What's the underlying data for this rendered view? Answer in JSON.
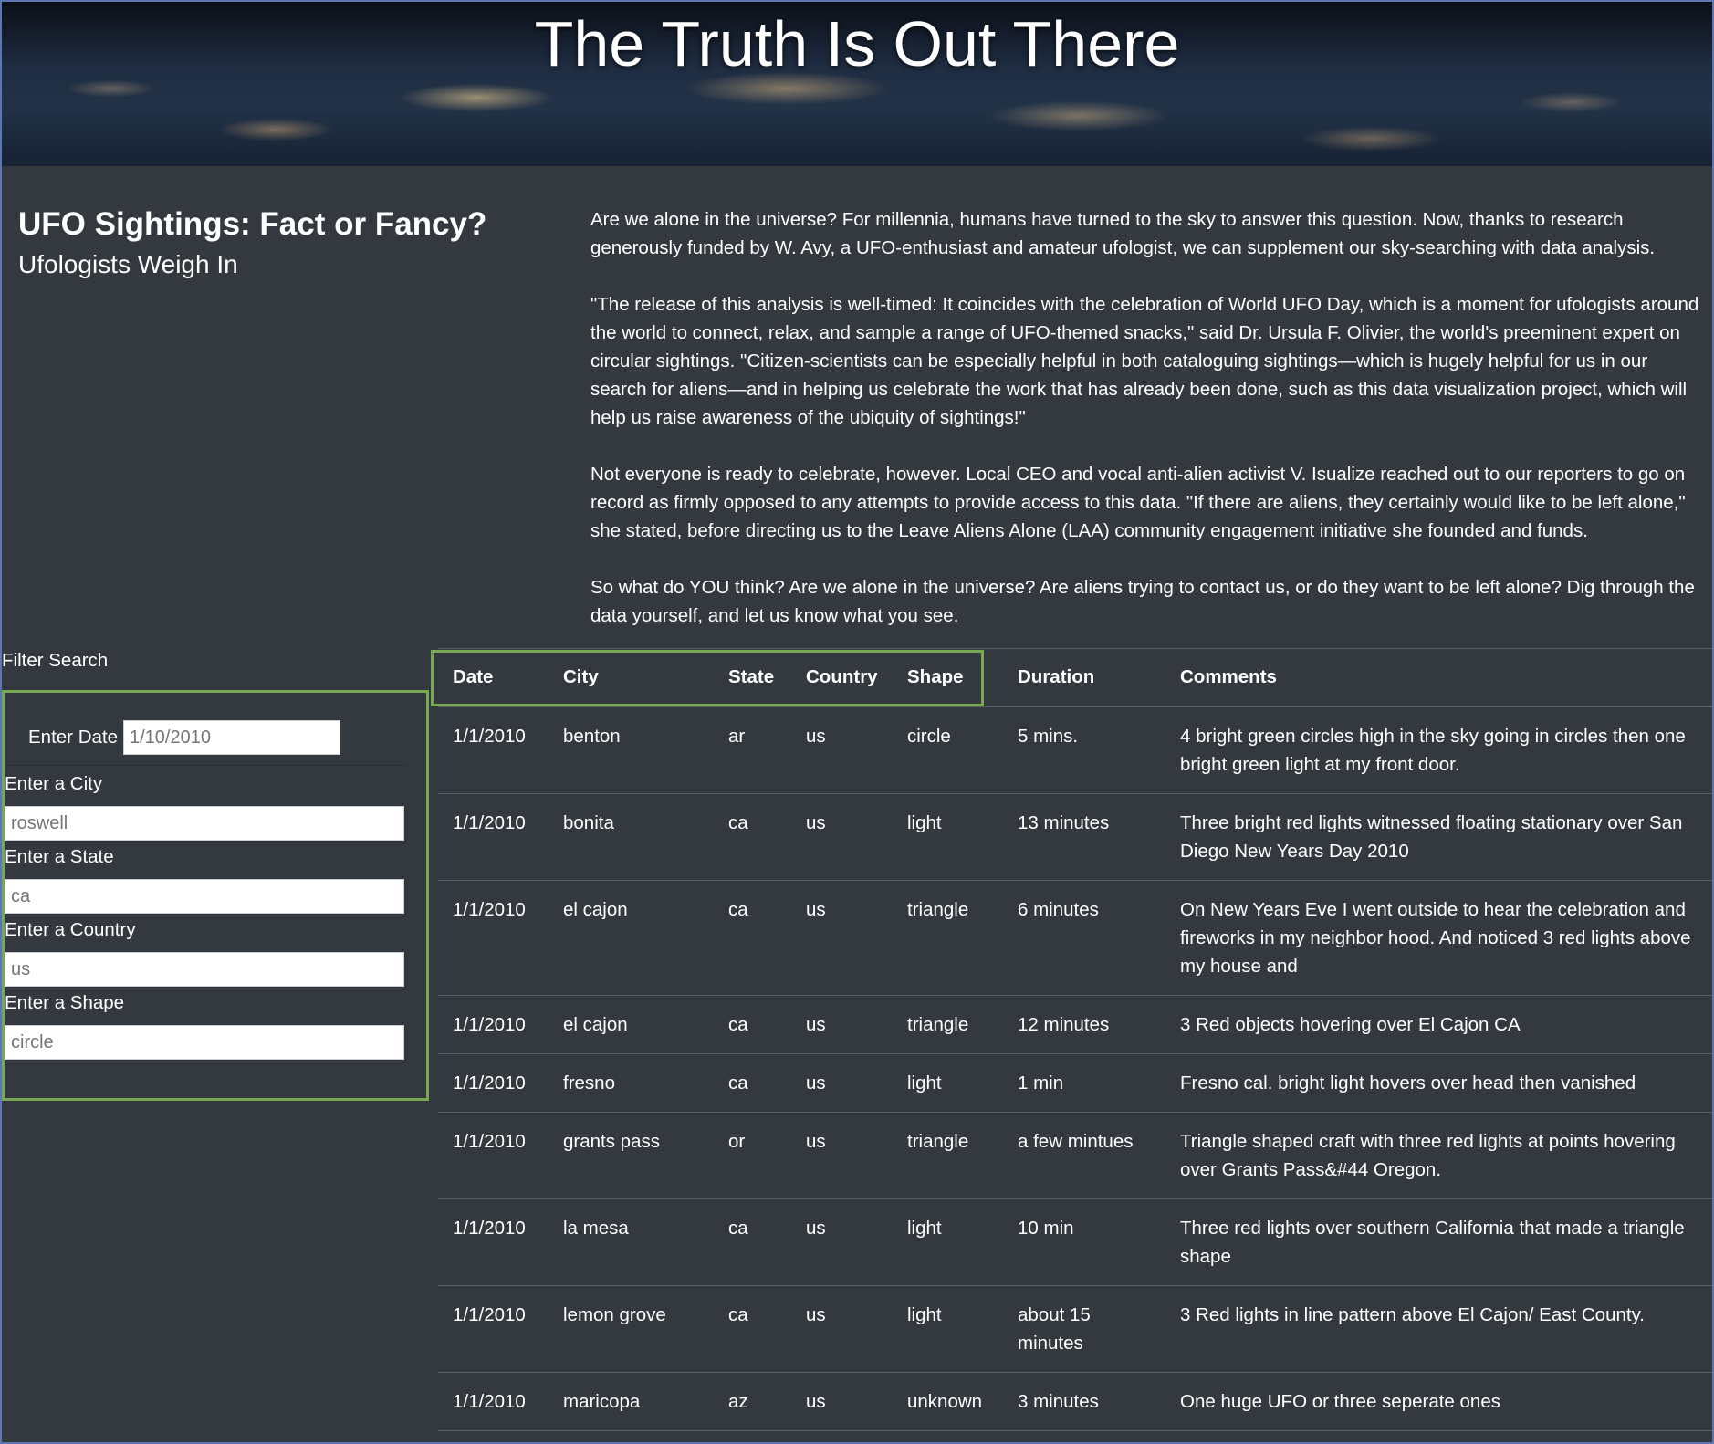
{
  "banner": {
    "title": "The Truth Is Out There"
  },
  "header": {
    "title": "UFO Sightings: Fact or Fancy?",
    "subtitle": "Ufologists Weigh In"
  },
  "intro": [
    "Are we alone in the universe? For millennia, humans have turned to the sky to answer this question. Now, thanks to research generously funded by W. Avy, a UFO-enthusiast and amateur ufologist, we can supplement our sky-searching with data analysis.",
    "\"The release of this analysis is well-timed: It coincides with the celebration of World UFO Day, which is a moment for ufologists around the world to connect, relax, and sample a range of UFO-themed snacks,\" said Dr. Ursula F. Olivier, the world's preeminent expert on circular sightings. \"Citizen-scientists can be especially helpful in both cataloguing sightings—which is hugely helpful for us in our search for aliens—and in helping us celebrate the work that has already been done, such as this data visualization project, which will help us raise awareness of the ubiquity of sightings!\"",
    "Not everyone is ready to celebrate, however. Local CEO and vocal anti-alien activist V. Isualize reached out to our reporters to go on record as firmly opposed to any attempts to provide access to this data. \"If there are aliens, they certainly would like to be left alone,\" she stated, before directing us to the Leave Aliens Alone (LAA) community engagement initiative she founded and funds.",
    "So what do YOU think? Are we alone in the universe? Are aliens trying to contact us, or do they want to be left alone? Dig through the data yourself, and let us know what you see."
  ],
  "filters": {
    "heading": "Filter Search",
    "date_label": "Enter Date",
    "date_placeholder": "1/10/2010",
    "city_label": "Enter a City",
    "city_placeholder": "roswell",
    "state_label": "Enter a State",
    "state_placeholder": "ca",
    "country_label": "Enter a Country",
    "country_placeholder": "us",
    "shape_label": "Enter a Shape",
    "shape_placeholder": "circle"
  },
  "table": {
    "columns": [
      "Date",
      "City",
      "State",
      "Country",
      "Shape",
      "Duration",
      "Comments"
    ],
    "rows": [
      [
        "1/1/2010",
        "benton",
        "ar",
        "us",
        "circle",
        "5 mins.",
        "4 bright green circles high in the sky going in circles then one bright green light at my front door."
      ],
      [
        "1/1/2010",
        "bonita",
        "ca",
        "us",
        "light",
        "13 minutes",
        "Three bright red lights witnessed floating stationary over San Diego New Years Day 2010"
      ],
      [
        "1/1/2010",
        "el cajon",
        "ca",
        "us",
        "triangle",
        "6 minutes",
        "On New Years Eve I went outside to hear the celebration and fireworks in my neighbor hood. And noticed 3 red lights above my house and"
      ],
      [
        "1/1/2010",
        "el cajon",
        "ca",
        "us",
        "triangle",
        "12 minutes",
        "3 Red objects hovering over El Cajon CA"
      ],
      [
        "1/1/2010",
        "fresno",
        "ca",
        "us",
        "light",
        "1 min",
        "Fresno cal. bright light hovers over head then vanished"
      ],
      [
        "1/1/2010",
        "grants pass",
        "or",
        "us",
        "triangle",
        "a few mintues",
        "Triangle shaped craft with three red lights at points hovering over Grants Pass&#44 Oregon."
      ],
      [
        "1/1/2010",
        "la mesa",
        "ca",
        "us",
        "light",
        "10 min",
        "Three red lights over southern California that made a triangle shape"
      ],
      [
        "1/1/2010",
        "lemon grove",
        "ca",
        "us",
        "light",
        "about 15 minutes",
        "3 Red lights in line pattern above El Cajon/ East County."
      ],
      [
        "1/1/2010",
        "maricopa",
        "az",
        "us",
        "unknown",
        "3 minutes",
        "One huge UFO or three seperate ones"
      ]
    ]
  }
}
